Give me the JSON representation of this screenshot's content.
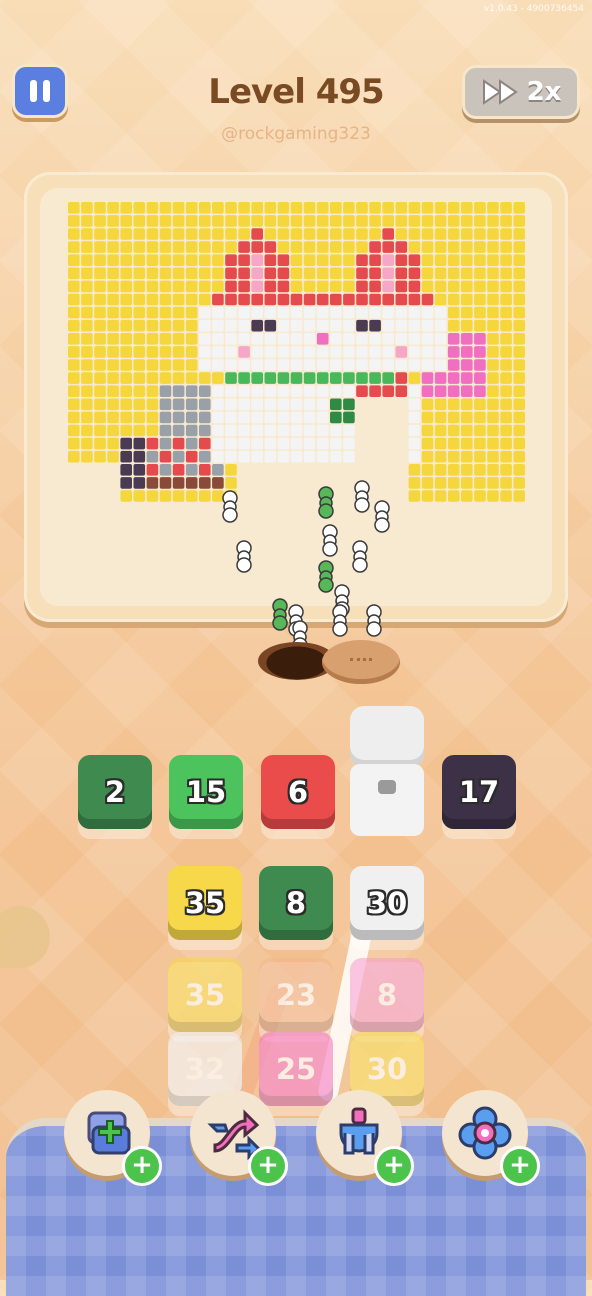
{
  "version": "v1.0.43 - 4900736454",
  "header": {
    "level_title": "Level 495",
    "username": "@rockgaming323",
    "speed_label": "2x"
  },
  "colors": {
    "dark_green": "#3f8a4f",
    "green": "#4cc35c",
    "red": "#ea4b4b",
    "dark_purple": "#3c3146",
    "yellow": "#f7d84a",
    "white": "#f0f0f0",
    "pink": "#f36fbe",
    "peach": "#f3b48b"
  },
  "active_row": [
    {
      "value": "2",
      "color": "#3f8a4f"
    },
    {
      "value": "15",
      "color": "#4cc35c"
    },
    {
      "value": "6",
      "color": "#ea4b4b"
    },
    {
      "value": "17",
      "color": "#3c3146"
    }
  ],
  "queue_columns": [
    [
      {
        "value": "35",
        "color": "#f7d84a"
      },
      {
        "value": "35",
        "color": "#f7d84a"
      },
      {
        "value": "32",
        "color": "#f0f0f0"
      }
    ],
    [
      {
        "value": "8",
        "color": "#3f8a4f"
      },
      {
        "value": "23",
        "color": "#f3b48b"
      },
      {
        "value": "25",
        "color": "#f36fbe"
      }
    ],
    [
      {
        "value": "30",
        "color": "#f0f0f0"
      },
      {
        "value": "8",
        "color": "#f59bcf"
      },
      {
        "value": "30",
        "color": "#f7d84a"
      }
    ]
  ],
  "boosters": [
    {
      "icon": "add-slot-icon"
    },
    {
      "icon": "shuffle-arrows-icon"
    },
    {
      "icon": "magnet-claw-icon"
    },
    {
      "icon": "flower-bloom-icon"
    }
  ]
}
